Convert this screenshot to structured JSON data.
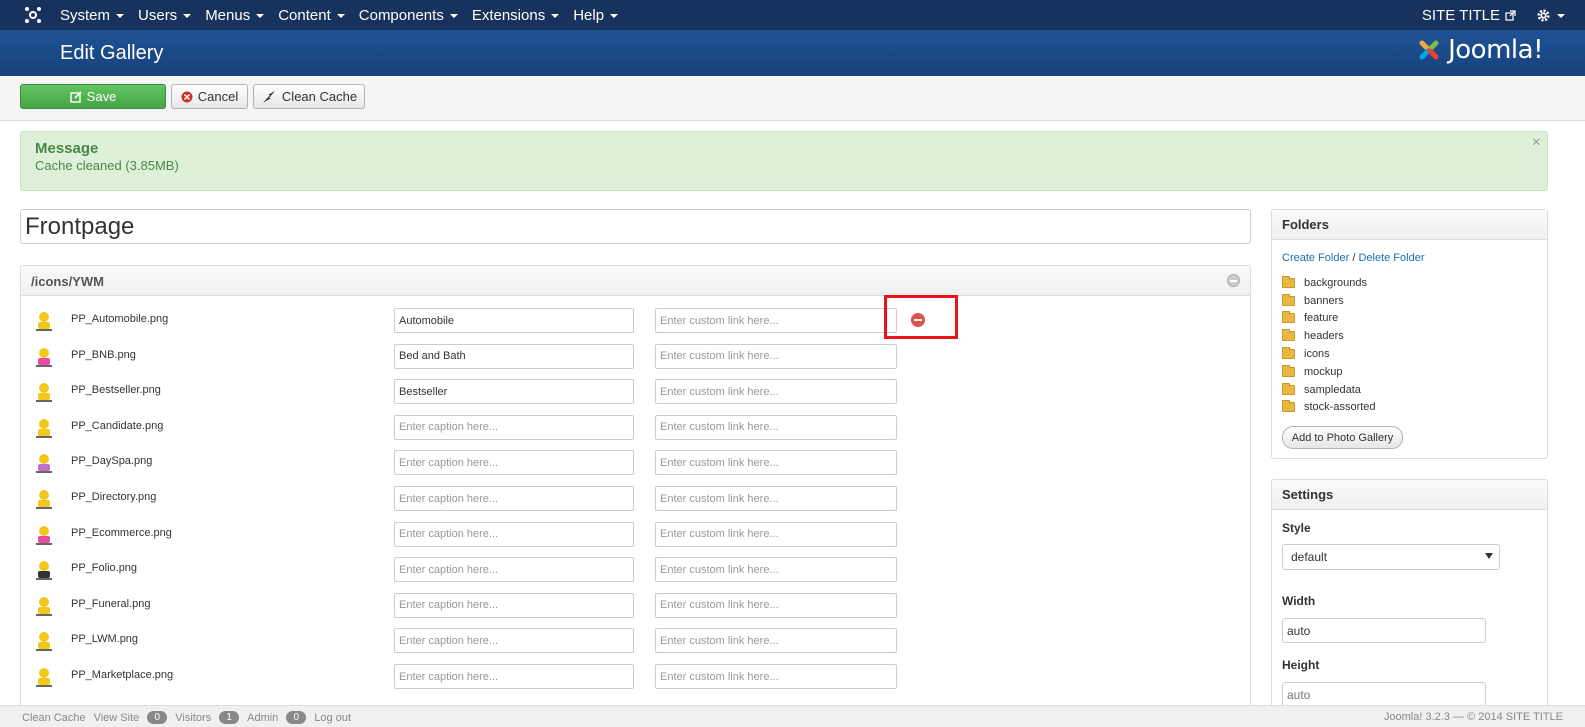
{
  "navbar": {
    "menu": [
      {
        "label": "System"
      },
      {
        "label": "Users"
      },
      {
        "label": "Menus"
      },
      {
        "label": "Content"
      },
      {
        "label": "Components"
      },
      {
        "label": "Extensions"
      },
      {
        "label": "Help"
      }
    ],
    "site_title": "SITE TITLE"
  },
  "header": {
    "title": "Edit Gallery",
    "brand": "Joomla!"
  },
  "toolbar": {
    "save_label": "Save",
    "cancel_label": "Cancel",
    "clean_cache_label": "Clean Cache"
  },
  "message": {
    "heading": "Message",
    "body": "Cache cleaned (3.85MB)"
  },
  "gallery": {
    "title": "Frontpage",
    "path": "/icons/YWM",
    "caption_placeholder": "Enter caption here...",
    "link_placeholder": "Enter custom link here...",
    "rows": [
      {
        "filename": "PP_Automobile.png",
        "caption": "Automobile"
      },
      {
        "filename": "PP_BNB.png",
        "caption": "Bed and Bath"
      },
      {
        "filename": "PP_Bestseller.png",
        "caption": "Bestseller"
      },
      {
        "filename": "PP_Candidate.png",
        "caption": ""
      },
      {
        "filename": "PP_DaySpa.png",
        "caption": ""
      },
      {
        "filename": "PP_Directory.png",
        "caption": ""
      },
      {
        "filename": "PP_Ecommerce.png",
        "caption": ""
      },
      {
        "filename": "PP_Folio.png",
        "caption": ""
      },
      {
        "filename": "PP_Funeral.png",
        "caption": ""
      },
      {
        "filename": "PP_LWM.png",
        "caption": ""
      },
      {
        "filename": "PP_Marketplace.png",
        "caption": ""
      }
    ]
  },
  "folders": {
    "heading": "Folders",
    "create_label": "Create Folder",
    "separator": "/",
    "delete_label": "Delete Folder",
    "items": [
      "backgrounds",
      "banners",
      "feature",
      "headers",
      "icons",
      "mockup",
      "sampledata",
      "stock-assorted"
    ],
    "add_button": "Add to Photo Gallery"
  },
  "settings": {
    "heading": "Settings",
    "style_label": "Style",
    "style_value": "default",
    "width_label": "Width",
    "width_value": "auto",
    "height_label": "Height",
    "height_placeholder": "auto"
  },
  "statusbar": {
    "clean_cache": "Clean Cache",
    "view_site": "View Site",
    "visitors_count": "0",
    "visitors_label": "Visitors",
    "admin_count": "1",
    "admin_label": "Admin",
    "messages_count": "0",
    "logout": "Log out",
    "copyright": "Joomla! 3.2.3 — © 2014 SITE TITLE"
  },
  "colors": {
    "navbar": "#17325c",
    "header": "#1a4b8c",
    "save": "#46a546",
    "highlight": "#e8141b"
  }
}
